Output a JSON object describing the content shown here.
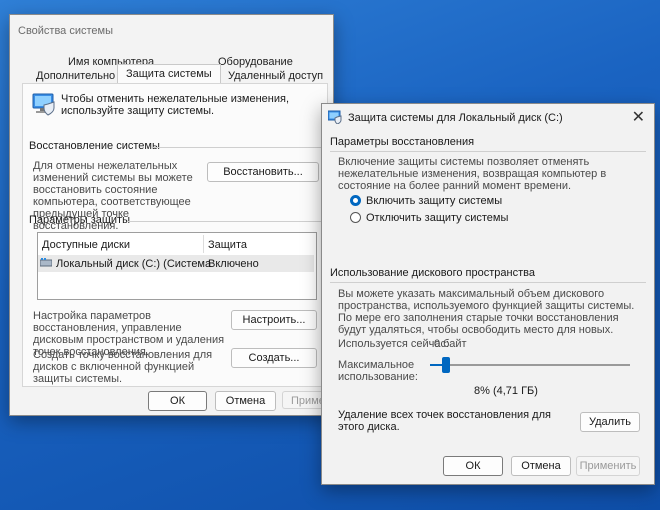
{
  "sysprops": {
    "title": "Свойства системы",
    "tabs": {
      "computer_name": "Имя компьютера",
      "hardware": "Оборудование",
      "advanced": "Дополнительно",
      "protection": "Защита системы",
      "remote": "Удаленный доступ"
    },
    "intro": "Чтобы отменить нежелательные изменения, используйте защиту системы.",
    "restore_header": "Восстановление системы",
    "restore_text": "Для отмены нежелательных изменений системы вы можете восстановить состояние компьютера, соответствующее предыдущей точке восстановления.",
    "restore_button": "Восстановить...",
    "protection_header": "Параметры защиты",
    "table": {
      "col_drives": "Доступные диски",
      "col_protection": "Защита",
      "rows": [
        {
          "drive": "Локальный диск (C:) (Система",
          "status": "Включено"
        }
      ]
    },
    "configure_text": "Настройка параметров восстановления, управление дисковым пространством и удаления точек восстановления.",
    "configure_button": "Настроить...",
    "create_text": "Создать точку восстановления для дисков с включенной функцией защиты системы.",
    "create_button": "Создать...",
    "ok": "ОК",
    "cancel": "Отмена",
    "apply": "Примени"
  },
  "dialog": {
    "title": "Защита системы для Локальный диск (C:)",
    "close": "✕",
    "restore_params_header": "Параметры восстановления",
    "restore_params_text": "Включение защиты системы позволяет отменять нежелательные изменения, возвращая компьютер в состояние на более ранний момент времени.",
    "radio_on": "Включить защиту системы",
    "radio_off": "Отключить защиту системы",
    "disk_usage_header": "Использование дискового пространства",
    "disk_usage_text": "Вы можете указать максимальный объем дискового пространства, используемого функцией защиты системы. По мере его заполнения старые точки восстановления будут удаляться, чтобы освободить место для новых.",
    "current_usage_label": "Используется сейчас:",
    "current_usage_value": "0 байт",
    "max_usage_label": "Максимальное использование:",
    "slider_percent": 8,
    "slider_value_text": "8% (4,71 ГБ)",
    "delete_text": "Удаление всех точек восстановления для этого диска.",
    "delete_button": "Удалить",
    "ok": "ОК",
    "cancel": "Отмена",
    "apply": "Применить"
  },
  "colors": {
    "accent": "#0067c0",
    "desktop": "#1a63c1"
  }
}
